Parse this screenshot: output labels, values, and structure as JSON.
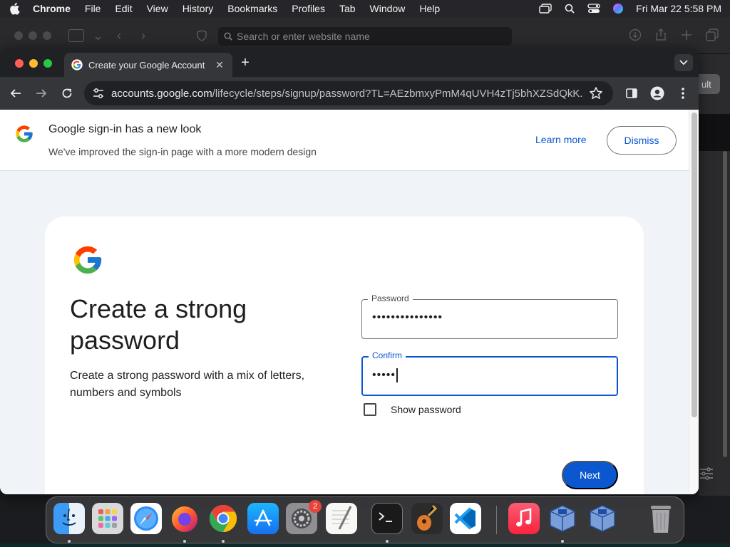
{
  "menubar": {
    "app": "Chrome",
    "items": [
      "File",
      "Edit",
      "View",
      "History",
      "Bookmarks",
      "Profiles",
      "Tab",
      "Window",
      "Help"
    ],
    "datetime": "Fri Mar 22  5:58 PM"
  },
  "background_window": {
    "search_placeholder": "Search or enter website name",
    "side_pill_text": "ult"
  },
  "chrome": {
    "tab_title": "Create your Google Account",
    "url_host": "accounts.google.com",
    "url_path": "/lifecycle/steps/signup/password?TL=AEzbmxyPmM4qUVH4zTj5bhXZSdQkK..."
  },
  "banner": {
    "title": "Google sign-in has a new look",
    "subtitle": "We've improved the sign-in page with a more modern design",
    "learn_more": "Learn more",
    "dismiss": "Dismiss"
  },
  "signup": {
    "heading": "Create a strong password",
    "description": "Create a strong password with a mix of letters, numbers and symbols",
    "password_label": "Password",
    "password_value": "•••••••••••••••",
    "confirm_label": "Confirm",
    "confirm_value": "•••••",
    "show_password_label": "Show password",
    "show_password_checked": false,
    "next_label": "Next"
  },
  "dock": {
    "items": [
      "Finder",
      "Launchpad",
      "Safari",
      "Firefox",
      "Google Chrome",
      "App Store",
      "System Settings",
      "TextEdit",
      "Terminal",
      "GarageBand",
      "Visual Studio Code",
      "Music",
      "VirtualBox",
      "VirtualBox VM",
      "Trash"
    ],
    "settings_badge": "2"
  },
  "colors": {
    "google_blue": "#0b57d0",
    "chrome_dark": "#202124",
    "page_bg": "#f0f4f9"
  }
}
